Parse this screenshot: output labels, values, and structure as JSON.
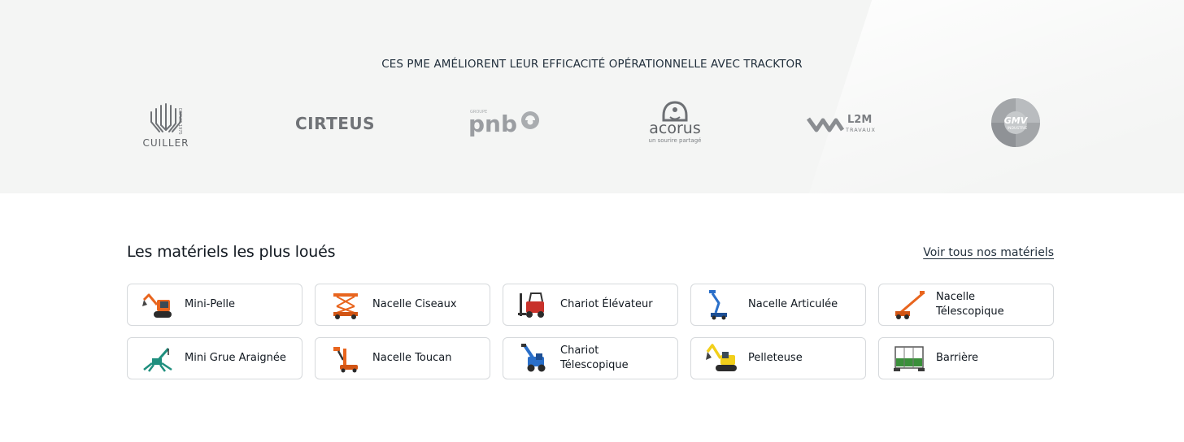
{
  "logos_section": {
    "heading": "CES PME AMÉLIORENT LEUR EFFICACITÉ OPÉRATIONNELLE AVEC TRACKTOR",
    "logos": [
      {
        "name": "CUILLER",
        "tagline": "DEPUIS 1975"
      },
      {
        "name": "CIRTEUS"
      },
      {
        "name": "pnb",
        "tagline": "GROUPE"
      },
      {
        "name": "acorus",
        "tagline": "un sourire partagé"
      },
      {
        "name": "L2M",
        "tagline": "TRAVAUX"
      },
      {
        "name": "GMV",
        "tagline": "INDUSTRIE"
      }
    ]
  },
  "materials": {
    "title": "Les matériels les plus loués",
    "see_all_label": "Voir tous nos matériels",
    "items": [
      {
        "label": "Mini-Pelle",
        "icon": "mini-excavator-icon"
      },
      {
        "label": "Nacelle Ciseaux",
        "icon": "scissor-lift-icon"
      },
      {
        "label": "Chariot Élévateur",
        "icon": "forklift-icon"
      },
      {
        "label": "Nacelle Articulée",
        "icon": "articulated-boom-lift-icon"
      },
      {
        "label": "Nacelle Télescopique",
        "icon": "telescopic-boom-lift-icon"
      },
      {
        "label": "Mini Grue Araignée",
        "icon": "spider-crane-icon"
      },
      {
        "label": "Nacelle Toucan",
        "icon": "toucan-lift-icon"
      },
      {
        "label": "Chariot Télescopique",
        "icon": "telehandler-icon"
      },
      {
        "label": "Pelleteuse",
        "icon": "excavator-icon"
      },
      {
        "label": "Barrière",
        "icon": "barrier-icon"
      }
    ]
  },
  "colors": {
    "band_background": "#f4f5f4",
    "logo_gray": "#7d8084",
    "card_border": "#d6d9dc",
    "text_dark": "#111820",
    "machine_orange": "#e8651e",
    "machine_yellow": "#f2cf1a",
    "machine_blue": "#2a6fc9",
    "machine_teal": "#1f8f7e",
    "machine_red": "#c8312a"
  }
}
